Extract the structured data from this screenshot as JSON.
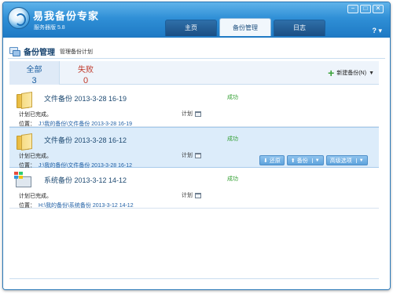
{
  "app": {
    "title": "易我备份专家",
    "edition": "服务器版 5.8"
  },
  "window_controls": {
    "minimize": "−",
    "maximize": "□",
    "close": "✕"
  },
  "help": {
    "label": "?",
    "caret": "▾"
  },
  "tabs": [
    {
      "label": "主页",
      "active": false
    },
    {
      "label": "备份管理",
      "active": true
    },
    {
      "label": "日志",
      "active": false
    }
  ],
  "page": {
    "title": "备份管理",
    "subtitle": "管理备份计划"
  },
  "stats": {
    "all_label": "全部",
    "all_count": "3",
    "fail_label": "失败",
    "fail_count": "0"
  },
  "new_backup": {
    "label": "新建备份(N)",
    "icon": "plus-icon"
  },
  "backups": [
    {
      "icon": "folder-icon",
      "name": "文件备份 2013-3-28 16-19",
      "status": "成功",
      "plan_text": "计划已完成。",
      "plan_label": "计划",
      "location_label": "位置：",
      "location": "J:\\我的备份\\文件备份 2013-3-28 16-19",
      "selected": false
    },
    {
      "icon": "folder-icon",
      "name": "文件备份 2013-3-28 16-12",
      "status": "成功",
      "plan_text": "计划已完成。",
      "plan_label": "计划",
      "location_label": "位置：",
      "location": "J:\\我的备份\\文件备份 2013-3-28 16-12",
      "selected": true
    },
    {
      "icon": "windows-system-icon",
      "name": "系统备份 2013-3-12 14-12",
      "status": "成功",
      "plan_text": "计划已完成。",
      "plan_label": "计划",
      "location_label": "位置：",
      "location": "H:\\我的备份\\系统备份 2013-3-12 14-12",
      "selected": false
    }
  ],
  "row_actions": {
    "restore": "还原",
    "backup": "备份",
    "advanced": "高级选项"
  },
  "colors": {
    "titlebar": "#2f8fd6",
    "success": "#2e9e2e",
    "fail": "#c0392b",
    "selected_row": "#dcecfa"
  }
}
